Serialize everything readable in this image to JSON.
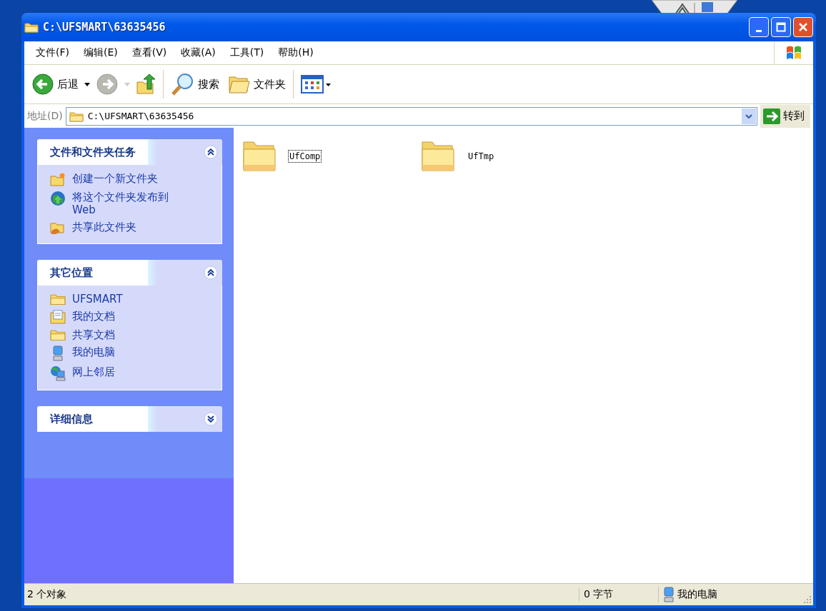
{
  "window": {
    "title": "C:\\UFSMART\\63635456"
  },
  "menu": [
    "文件(F)",
    "编辑(E)",
    "查看(V)",
    "收藏(A)",
    "工具(T)",
    "帮助(H)"
  ],
  "toolbar": {
    "back": {
      "label": "后退",
      "disabled": false
    },
    "forward": {
      "disabled": true
    },
    "search": "搜索",
    "folders": "文件夹"
  },
  "address": {
    "label": "地址(D)",
    "value": "C:\\UFSMART\\63635456",
    "go": "转到"
  },
  "panels": [
    {
      "title": "文件和文件夹任务",
      "expanded": true,
      "items": [
        {
          "kind": "newfolder",
          "label": "创建一个新文件夹"
        },
        {
          "kind": "web",
          "label": "将这个文件夹发布到 Web"
        },
        {
          "kind": "share",
          "label": "共享此文件夹"
        }
      ]
    },
    {
      "title": "其它位置",
      "expanded": true,
      "items": [
        {
          "kind": "folder",
          "label": "UFSMART"
        },
        {
          "kind": "docs",
          "label": "我的文档"
        },
        {
          "kind": "folder",
          "label": "共享文档"
        },
        {
          "kind": "computer",
          "label": "我的电脑"
        },
        {
          "kind": "network",
          "label": "网上邻居"
        }
      ]
    },
    {
      "title": "详细信息",
      "expanded": false
    }
  ],
  "files": [
    {
      "name": "UfComp",
      "selected": true
    },
    {
      "name": "UfTmp",
      "selected": false
    }
  ],
  "status_bar": {
    "objects": "2 个对象",
    "size": "0 字节",
    "location": "我的电脑"
  }
}
